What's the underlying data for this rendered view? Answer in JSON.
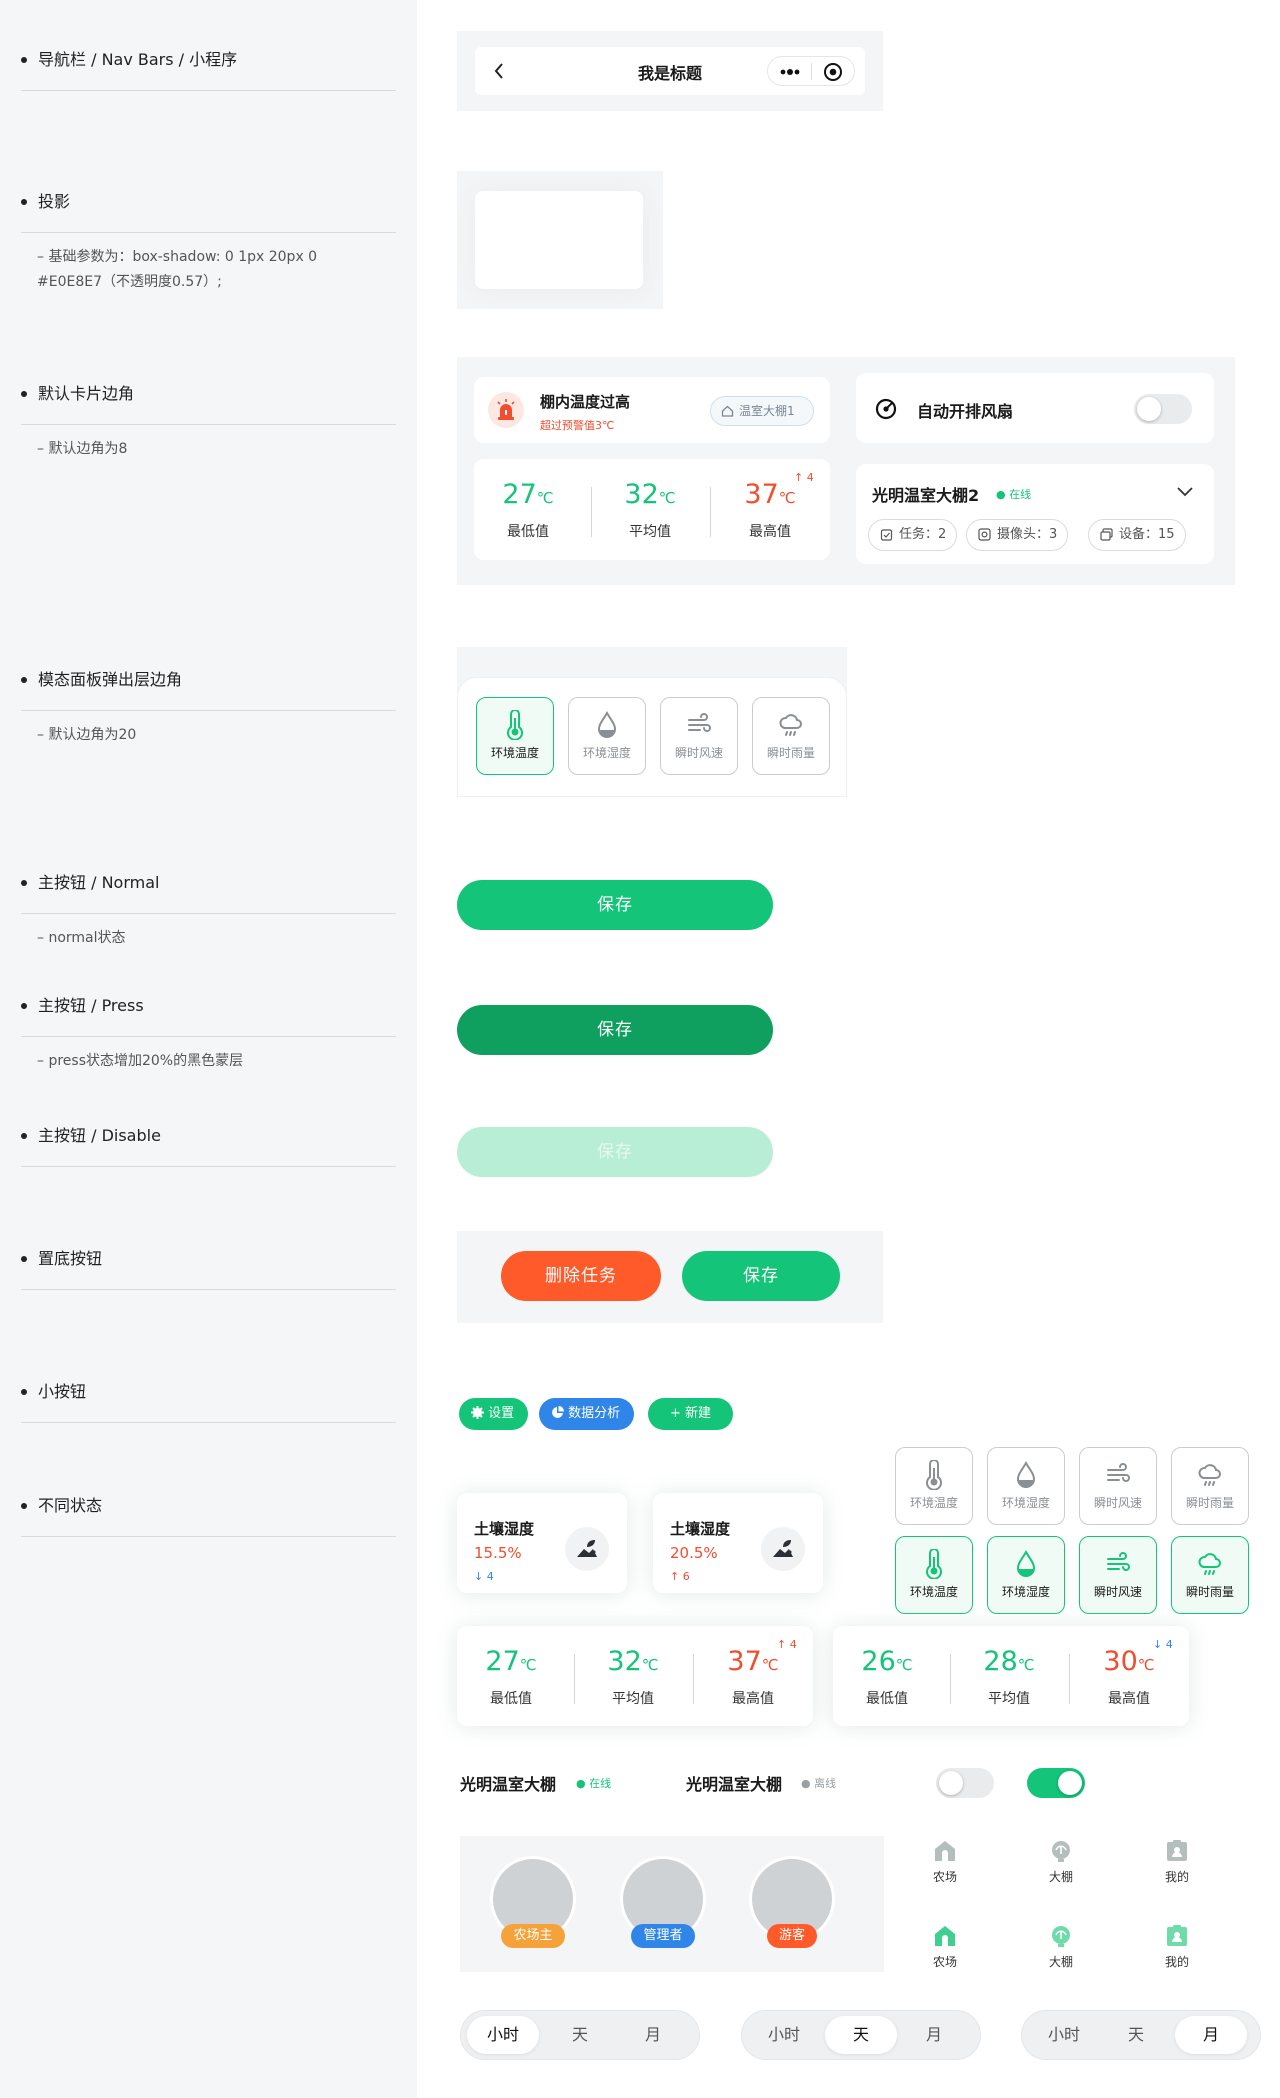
{
  "sections": [
    {
      "title": "导航栏 / Nav Bars / 小程序",
      "desc": ""
    },
    {
      "title": "投影",
      "desc": "– 基础参数为：box-shadow: 0 1px 20px 0 #E0E8E7（不透明度0.57）;"
    },
    {
      "title": "默认卡片边角",
      "desc": "– 默认边角为8"
    },
    {
      "title": "模态面板弹出层边角",
      "desc": "– 默认边角为20"
    },
    {
      "title": "主按钮 / Normal",
      "desc": "– normal状态"
    },
    {
      "title": "主按钮 / Press",
      "desc": "– press状态增加20%的黑色蒙层"
    },
    {
      "title": "主按钮 / Disable",
      "desc": ""
    },
    {
      "title": "置底按钮",
      "desc": ""
    },
    {
      "title": "小按钮",
      "desc": ""
    },
    {
      "title": "不同状态",
      "desc": ""
    }
  ],
  "navbar": {
    "title": "我是标题"
  },
  "alarm": {
    "title": "棚内温度过高",
    "sub": "超过预警值3℃",
    "tag": "温室大棚1"
  },
  "fan": {
    "label": "自动开排风扇"
  },
  "stats1": {
    "min": "27",
    "avg": "32",
    "max": "37",
    "unit": "℃",
    "min_label": "最低值",
    "avg_label": "平均值",
    "max_label": "最高值",
    "delta": "4"
  },
  "greenhouse_card": {
    "name": "光明温室大棚2",
    "status": "在线",
    "task": "任务：2",
    "camera": "摄像头：3",
    "device": "设备：15"
  },
  "sensors": {
    "temp": "环境温度",
    "humidity": "环境湿度",
    "wind": "瞬时风速",
    "rain": "瞬时雨量"
  },
  "buttons": {
    "save": "保存",
    "delete": "删除任务"
  },
  "small_buttons": {
    "settings": "设置",
    "analysis": "数据分析",
    "new": "+ 新建"
  },
  "soil": [
    {
      "label": "土壤湿度",
      "value": "15.5%",
      "delta": "4",
      "dir": "down"
    },
    {
      "label": "土壤湿度",
      "value": "20.5%",
      "delta": "6",
      "dir": "up"
    }
  ],
  "stats2": {
    "min": "27",
    "avg": "32",
    "max": "37",
    "delta": "4"
  },
  "stats3": {
    "min": "26",
    "avg": "28",
    "max": "30",
    "delta": "4"
  },
  "status_rows": {
    "name1": "光明温室大棚",
    "status1": "在线",
    "name2": "光明温室大棚",
    "status2": "离线"
  },
  "roles": {
    "owner": "农场主",
    "admin": "管理者",
    "visitor": "游客"
  },
  "tabbar": {
    "farm": "农场",
    "shed": "大棚",
    "mine": "我的"
  },
  "segment": {
    "hour": "小时",
    "day": "天",
    "month": "月"
  },
  "colors": {
    "primary": "#14c479",
    "press": "#0f9f5e",
    "disabled": "#b8eed5",
    "danger": "#ff5a2a",
    "blue": "#2f86e8"
  }
}
